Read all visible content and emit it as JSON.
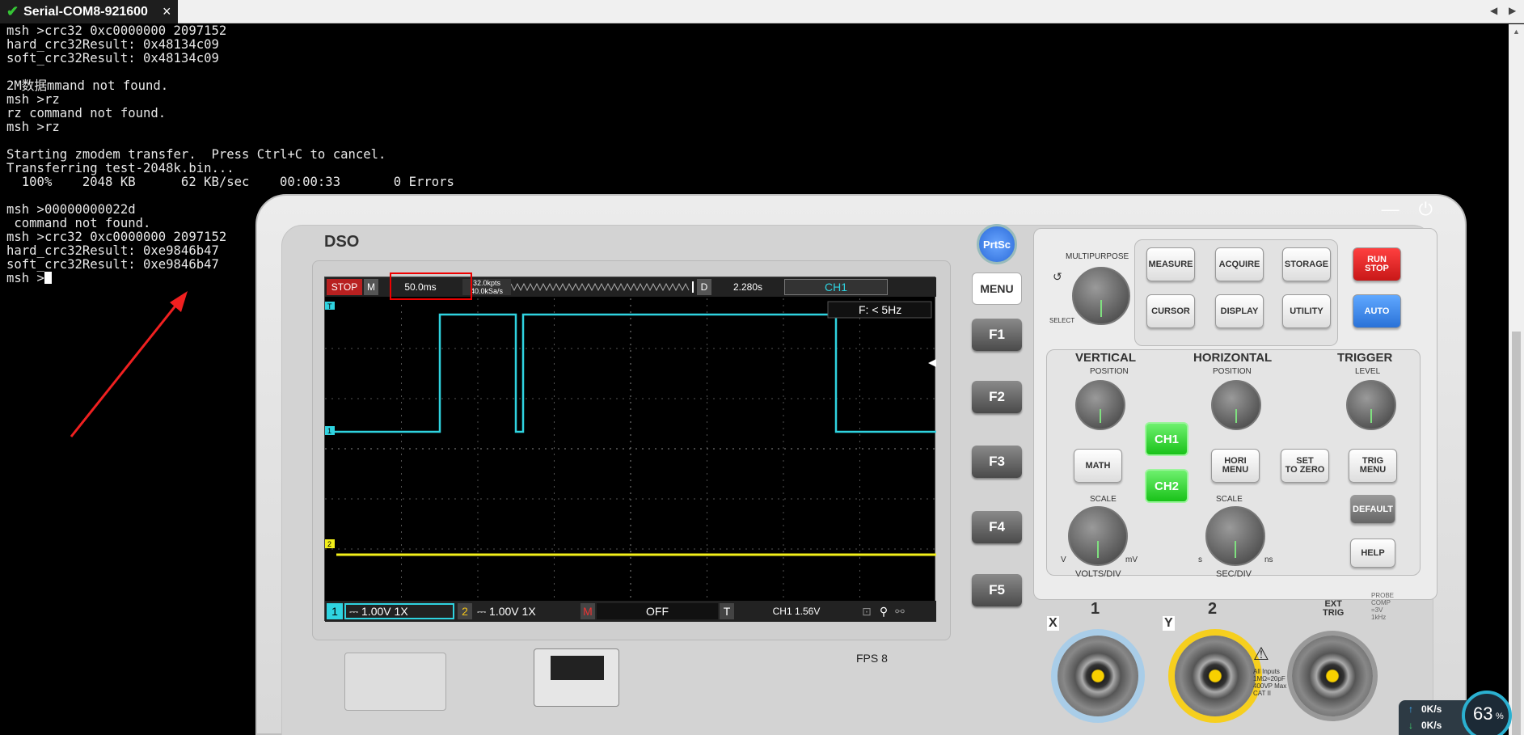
{
  "tab": {
    "title": "Serial-COM8-921600",
    "close": "×"
  },
  "nav": {
    "prev": "◀",
    "next": "▶"
  },
  "terminal": {
    "lines": [
      "msh >crc32 0xc0000000 2097152",
      "hard_crc32Result: 0x48134c09",
      "soft_crc32Result: 0x48134c09",
      "",
      "2M数据mmand not found.",
      "msh >rz",
      "rz command not found.",
      "msh >rz",
      "",
      "Starting zmodem transfer.  Press Ctrl+C to cancel.",
      "Transferring test-2048k.bin...",
      "  100%    2048 KB      62 KB/sec    00:00:33       0 Errors",
      "",
      "msh >00000000022d",
      " command not found.",
      "msh >crc32 0xc0000000 2097152",
      "hard_crc32Result: 0xe9846b47",
      "soft_crc32Result: 0xe9846b47",
      "msh >"
    ]
  },
  "dso": {
    "title": "DSO",
    "prtsc": "PrtSc",
    "menu": "MENU",
    "fkeys": [
      "F1",
      "F2",
      "F3",
      "F4",
      "F5"
    ],
    "fps": "FPS 8",
    "win_min": "—",
    "win_power": "⏻",
    "screen": {
      "run_state": "STOP",
      "mode": "M",
      "timebase": "50.0ms",
      "mem": "32.0kpts",
      "rate": "40.0kSa/s",
      "d_label": "D",
      "delay": "2.280s",
      "trig_source": "CH1",
      "freq": "F: < 5Hz",
      "ch1_num": "1",
      "ch1_setting": "⎓ 1.00V 1X",
      "ch2_num": "2",
      "ch2_setting": "⎓ 1.00V 1X",
      "math_label": "M",
      "math_state": "OFF",
      "t_label": "T",
      "trig_info": "CH1 1.56V",
      "ch1_marker": "1",
      "ch2_marker": "2",
      "trig_marker": "T"
    },
    "controls": {
      "multipurpose": "MULTIPURPOSE",
      "select": "SELECT",
      "measure": "MEASURE",
      "acquire": "ACQUIRE",
      "storage": "STORAGE",
      "cursor": "CURSOR",
      "display": "DISPLAY",
      "utility": "UTILITY",
      "run_stop": "RUN\nSTOP",
      "auto": "AUTO",
      "vertical": "VERTICAL",
      "horizontal": "HORIZONTAL",
      "trigger": "TRIGGER",
      "v_position": "POSITION",
      "h_position": "POSITION",
      "t_level": "LEVEL",
      "math": "MATH",
      "hori_menu": "HORI\nMENU",
      "set_zero": "SET\nTO ZERO",
      "trig_menu": "TRIG\nMENU",
      "ch1": "CH1",
      "ch2": "CH2",
      "v_scale": "SCALE",
      "h_scale": "SCALE",
      "volts_div": "VOLTS/DIV",
      "sec_div": "SEC/DIV",
      "v_lo": "V",
      "v_hi": "mV",
      "s_lo": "s",
      "s_hi": "ns",
      "default": "DEFAULT",
      "help": "HELP",
      "probe_comp": "PROBE\nCOMP\n=3V\n1kHz",
      "x_label": "X",
      "y_label": "Y",
      "in1": "1",
      "in2": "2",
      "ext_trig": "EXT\nTRIG",
      "inputs_note": "All Inputs\n1MΩ≈20pF\n400VP Max\nCAT II"
    }
  },
  "netstat": {
    "up": "0K/s",
    "down": "0K/s",
    "cpu": "63",
    "cpu_unit": "%"
  },
  "colors": {
    "ch1": "#2fd3e0",
    "ch2": "#f2ef1a",
    "stop": "#b82020",
    "run_stop": "#e01e1e",
    "auto": "#3c8cf0"
  }
}
